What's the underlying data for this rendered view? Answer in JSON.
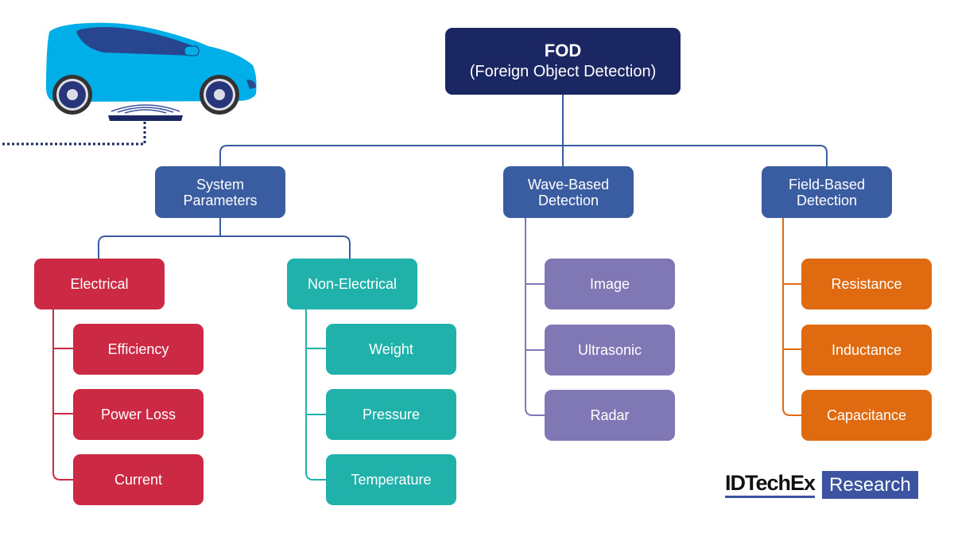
{
  "root": {
    "title": "FOD",
    "subtitle": "(Foreign Object Detection)"
  },
  "categories": [
    {
      "label_line1": "System",
      "label_line2": "Parameters"
    },
    {
      "label_line1": "Wave-Based",
      "label_line2": "Detection"
    },
    {
      "label_line1": "Field-Based",
      "label_line2": "Detection"
    }
  ],
  "system_parameters": {
    "electrical": {
      "label": "Electrical",
      "items": [
        "Efficiency",
        "Power Loss",
        "Current"
      ]
    },
    "non_electrical": {
      "label": "Non-Electrical",
      "items": [
        "Weight",
        "Pressure",
        "Temperature"
      ]
    }
  },
  "wave_based": {
    "items": [
      "Image",
      "Ultrasonic",
      "Radar"
    ]
  },
  "field_based": {
    "items": [
      "Resistance",
      "Inductance",
      "Capacitance"
    ]
  },
  "colors": {
    "root": "#1a2762",
    "category": "#3a5ca1",
    "electrical": "#cc2944",
    "non_electrical": "#20b2aa",
    "wave": "#7f78b4",
    "field": "#e06a10",
    "car_body": "#00aee8"
  },
  "logo": {
    "brand": "IDTechEx",
    "tag": "Research"
  }
}
